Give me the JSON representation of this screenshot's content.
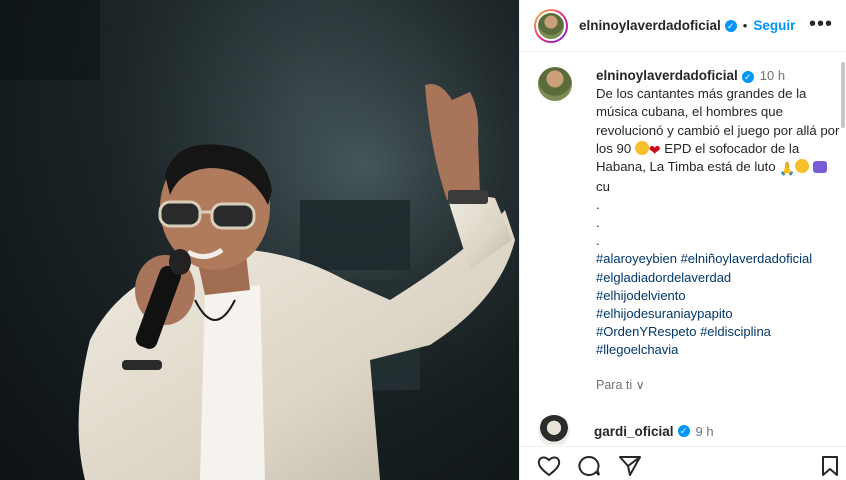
{
  "post": {
    "username": "elninoylaverdadoficial",
    "verified_mark": "✓",
    "follow_label": "Seguir",
    "separator": "•",
    "more_label": "•••",
    "time": "10 h",
    "caption_line1": "De los cantantes más grandes de la música cubana, el hombres que revolucionó y cambió el juego por allá por los 90",
    "caption_line2": "EPD el sofocador de la Habana, La Timba está de luto",
    "caption_line3": "cu",
    "heart": "❤",
    "pray": "🙏",
    "dot": ".",
    "hashtags": [
      "#alaroyeybien",
      "#elniñoylaverdadoficial",
      "#elgladiadordelaverdad",
      "#elhijodelviento",
      "#elhijodesuraniaypapito",
      "#OrdenYRespeto",
      "#eldisciplina",
      "#llegoelchavia"
    ],
    "hashtag_line2": "#elniñoylaverdadoficial",
    "hashtag_line6": "#eldisciplina",
    "translate_label": "Para ti ∨"
  },
  "comment": {
    "username": "gardi_oficial",
    "time": "9 h"
  },
  "icons": {
    "like": "heart-outline-icon",
    "comment": "comment-bubble-icon",
    "share": "paper-plane-icon",
    "save": "bookmark-icon"
  },
  "colors": {
    "accent": "#0095f6",
    "hashtag": "#00376b",
    "muted": "#737373"
  }
}
